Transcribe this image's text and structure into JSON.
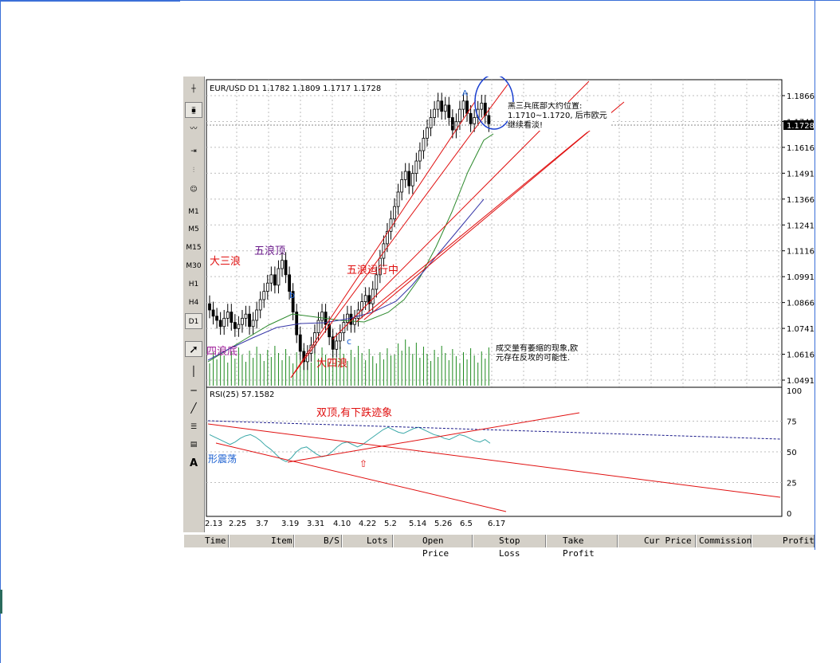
{
  "window": {
    "toolbar": {
      "icons": [
        "crosshair-icon",
        "candle-icon",
        "line-chart-icon",
        "scroll-icon",
        "autoscroll-icon",
        "expert-icon"
      ],
      "timeframes": [
        "M1",
        "M5",
        "M15",
        "M30",
        "H1",
        "H4",
        "D1"
      ],
      "draw_tools": [
        "cursor-icon",
        "vertical-line-icon",
        "horizontal-line-icon",
        "trendline-icon",
        "channel-icon",
        "fibo-icon",
        "text-icon"
      ],
      "text_tool_label": "A"
    },
    "status_columns": [
      "Time",
      "Item",
      "B/S",
      "Lots",
      "Open Price",
      "Stop Loss",
      "Take Profit",
      "Cur Price",
      "Commission",
      "Profit"
    ]
  },
  "chart_data": [
    {
      "type": "candlestick",
      "title": "EUR/USD D1  1.1782  1.1809  1.1717  1.1728",
      "current_price": "1.1728",
      "y_ticks": [
        "1.1866",
        "1.1741",
        "1.1616",
        "1.1491",
        "1.1366",
        "1.1241",
        "1.1116",
        "1.0991",
        "1.0866",
        "1.0741",
        "1.0616",
        "1.0491"
      ],
      "x_ticks": [
        "2.13",
        "2.25",
        "3.7",
        "3.19",
        "3.31",
        "4.10",
        "4.22",
        "5.2",
        "5.14",
        "5.26",
        "6.5",
        "6.17"
      ],
      "annotations": {
        "wave3": "大三浪",
        "wave5_top": "五浪顶",
        "wave4_bottom": "四浪底",
        "wave5_running": "五浪运行中",
        "big_wave4": "大四浪",
        "label_b": "b",
        "label_c": "c",
        "label_a": "A",
        "excl": "!!!",
        "note_top": "黑三兵底部大约位置: 1.1710~1.1720, 后市欧元继续看淡!",
        "note_volume": "成交量有萎缩的现象,欧元存在反攻的可能性."
      },
      "close": [
        1.083,
        1.08,
        1.078,
        1.075,
        1.079,
        1.082,
        1.077,
        1.074,
        1.076,
        1.079,
        1.081,
        1.075,
        1.078,
        1.083,
        1.088,
        1.092,
        1.096,
        1.1,
        1.095,
        1.103,
        1.107,
        1.1,
        1.092,
        1.082,
        1.071,
        1.063,
        1.058,
        1.062,
        1.066,
        1.072,
        1.078,
        1.082,
        1.076,
        1.07,
        1.064,
        1.068,
        1.072,
        1.077,
        1.081,
        1.076,
        1.079,
        1.083,
        1.087,
        1.09,
        1.086,
        1.093,
        1.1,
        1.108,
        1.115,
        1.121,
        1.127,
        1.133,
        1.14,
        1.146,
        1.15,
        1.143,
        1.149,
        1.155,
        1.16,
        1.166,
        1.171,
        1.176,
        1.18,
        1.184,
        1.179,
        1.182,
        1.176,
        1.17,
        1.174,
        1.18,
        1.184,
        1.178,
        1.173,
        1.176,
        1.18,
        1.183,
        1.177,
        1.173
      ]
    },
    {
      "type": "line",
      "title": "RSI(25)  57.1582",
      "y_ticks": [
        "100",
        "75",
        "50",
        "25",
        "0"
      ],
      "values": [
        64,
        62,
        60,
        58,
        56,
        58,
        61,
        63,
        64,
        62,
        59,
        55,
        52,
        48,
        44,
        42,
        45,
        50,
        53,
        54,
        51,
        48,
        46,
        47,
        50,
        54,
        57,
        58,
        56,
        54,
        56,
        59,
        62,
        65,
        68,
        70,
        68,
        66,
        65,
        67,
        69,
        70,
        68,
        66,
        64,
        63,
        61,
        60,
        62,
        64,
        63,
        61,
        59,
        58,
        60,
        57
      ],
      "annotations": {
        "double_top": "双顶,有下跌迹象",
        "range": "形震荡",
        "arrow": "⇧"
      }
    }
  ]
}
